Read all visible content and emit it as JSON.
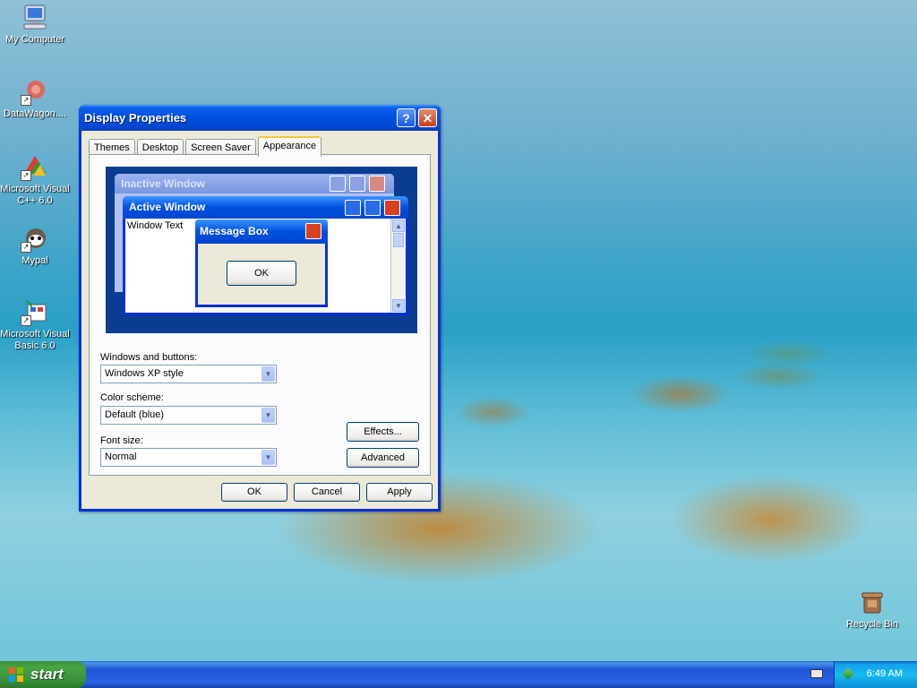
{
  "desktop": {
    "icons": [
      {
        "label": "My Computer",
        "icon": "my-computer-icon"
      },
      {
        "label": "DataWagon....",
        "icon": "datawagon-icon"
      },
      {
        "label": "Microsoft Visual C++ 6.0",
        "icon": "visual-cpp-icon"
      },
      {
        "label": "Mypal",
        "icon": "mypal-icon"
      },
      {
        "label": "Microsoft Visual Basic 6.0",
        "icon": "visual-basic-icon"
      },
      {
        "label": "Recycle Bin",
        "icon": "recycle-bin-icon"
      }
    ]
  },
  "window": {
    "title": "Display Properties",
    "help_label": "?",
    "close_label": "✕",
    "tabs": [
      {
        "label": "Themes",
        "active": false
      },
      {
        "label": "Desktop",
        "active": false
      },
      {
        "label": "Screen Saver",
        "active": false
      },
      {
        "label": "Appearance",
        "active": true
      }
    ],
    "preview": {
      "inactive_title": "Inactive Window",
      "active_title": "Active Window",
      "window_text": "Window Text",
      "message_title": "Message Box",
      "message_ok": "OK"
    },
    "windows_buttons": {
      "label": "Windows and buttons:",
      "value": "Windows XP style"
    },
    "color_scheme": {
      "label": "Color scheme:",
      "value": "Default (blue)"
    },
    "font_size": {
      "label": "Font size:",
      "value": "Normal"
    },
    "effects_label": "Effects...",
    "advanced_label": "Advanced",
    "ok_label": "OK",
    "cancel_label": "Cancel",
    "apply_label": "Apply"
  },
  "taskbar": {
    "start_label": "start",
    "clock": "6:49 AM"
  },
  "colors": {
    "titlebar": "#0050e0",
    "dialog_bg": "#ece9d8",
    "taskbar": "#2663e0",
    "start_green": "#3a913a"
  }
}
